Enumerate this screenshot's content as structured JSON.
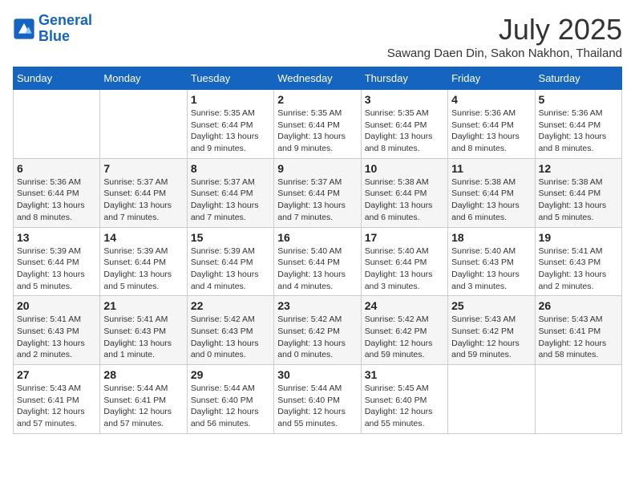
{
  "header": {
    "logo_line1": "General",
    "logo_line2": "Blue",
    "month": "July 2025",
    "location": "Sawang Daen Din, Sakon Nakhon, Thailand"
  },
  "weekdays": [
    "Sunday",
    "Monday",
    "Tuesday",
    "Wednesday",
    "Thursday",
    "Friday",
    "Saturday"
  ],
  "weeks": [
    [
      {
        "day": "",
        "info": ""
      },
      {
        "day": "",
        "info": ""
      },
      {
        "day": "1",
        "info": "Sunrise: 5:35 AM\nSunset: 6:44 PM\nDaylight: 13 hours and 9 minutes."
      },
      {
        "day": "2",
        "info": "Sunrise: 5:35 AM\nSunset: 6:44 PM\nDaylight: 13 hours and 9 minutes."
      },
      {
        "day": "3",
        "info": "Sunrise: 5:35 AM\nSunset: 6:44 PM\nDaylight: 13 hours and 8 minutes."
      },
      {
        "day": "4",
        "info": "Sunrise: 5:36 AM\nSunset: 6:44 PM\nDaylight: 13 hours and 8 minutes."
      },
      {
        "day": "5",
        "info": "Sunrise: 5:36 AM\nSunset: 6:44 PM\nDaylight: 13 hours and 8 minutes."
      }
    ],
    [
      {
        "day": "6",
        "info": "Sunrise: 5:36 AM\nSunset: 6:44 PM\nDaylight: 13 hours and 8 minutes."
      },
      {
        "day": "7",
        "info": "Sunrise: 5:37 AM\nSunset: 6:44 PM\nDaylight: 13 hours and 7 minutes."
      },
      {
        "day": "8",
        "info": "Sunrise: 5:37 AM\nSunset: 6:44 PM\nDaylight: 13 hours and 7 minutes."
      },
      {
        "day": "9",
        "info": "Sunrise: 5:37 AM\nSunset: 6:44 PM\nDaylight: 13 hours and 7 minutes."
      },
      {
        "day": "10",
        "info": "Sunrise: 5:38 AM\nSunset: 6:44 PM\nDaylight: 13 hours and 6 minutes."
      },
      {
        "day": "11",
        "info": "Sunrise: 5:38 AM\nSunset: 6:44 PM\nDaylight: 13 hours and 6 minutes."
      },
      {
        "day": "12",
        "info": "Sunrise: 5:38 AM\nSunset: 6:44 PM\nDaylight: 13 hours and 5 minutes."
      }
    ],
    [
      {
        "day": "13",
        "info": "Sunrise: 5:39 AM\nSunset: 6:44 PM\nDaylight: 13 hours and 5 minutes."
      },
      {
        "day": "14",
        "info": "Sunrise: 5:39 AM\nSunset: 6:44 PM\nDaylight: 13 hours and 5 minutes."
      },
      {
        "day": "15",
        "info": "Sunrise: 5:39 AM\nSunset: 6:44 PM\nDaylight: 13 hours and 4 minutes."
      },
      {
        "day": "16",
        "info": "Sunrise: 5:40 AM\nSunset: 6:44 PM\nDaylight: 13 hours and 4 minutes."
      },
      {
        "day": "17",
        "info": "Sunrise: 5:40 AM\nSunset: 6:44 PM\nDaylight: 13 hours and 3 minutes."
      },
      {
        "day": "18",
        "info": "Sunrise: 5:40 AM\nSunset: 6:43 PM\nDaylight: 13 hours and 3 minutes."
      },
      {
        "day": "19",
        "info": "Sunrise: 5:41 AM\nSunset: 6:43 PM\nDaylight: 13 hours and 2 minutes."
      }
    ],
    [
      {
        "day": "20",
        "info": "Sunrise: 5:41 AM\nSunset: 6:43 PM\nDaylight: 13 hours and 2 minutes."
      },
      {
        "day": "21",
        "info": "Sunrise: 5:41 AM\nSunset: 6:43 PM\nDaylight: 13 hours and 1 minute."
      },
      {
        "day": "22",
        "info": "Sunrise: 5:42 AM\nSunset: 6:43 PM\nDaylight: 13 hours and 0 minutes."
      },
      {
        "day": "23",
        "info": "Sunrise: 5:42 AM\nSunset: 6:42 PM\nDaylight: 13 hours and 0 minutes."
      },
      {
        "day": "24",
        "info": "Sunrise: 5:42 AM\nSunset: 6:42 PM\nDaylight: 12 hours and 59 minutes."
      },
      {
        "day": "25",
        "info": "Sunrise: 5:43 AM\nSunset: 6:42 PM\nDaylight: 12 hours and 59 minutes."
      },
      {
        "day": "26",
        "info": "Sunrise: 5:43 AM\nSunset: 6:41 PM\nDaylight: 12 hours and 58 minutes."
      }
    ],
    [
      {
        "day": "27",
        "info": "Sunrise: 5:43 AM\nSunset: 6:41 PM\nDaylight: 12 hours and 57 minutes."
      },
      {
        "day": "28",
        "info": "Sunrise: 5:44 AM\nSunset: 6:41 PM\nDaylight: 12 hours and 57 minutes."
      },
      {
        "day": "29",
        "info": "Sunrise: 5:44 AM\nSunset: 6:40 PM\nDaylight: 12 hours and 56 minutes."
      },
      {
        "day": "30",
        "info": "Sunrise: 5:44 AM\nSunset: 6:40 PM\nDaylight: 12 hours and 55 minutes."
      },
      {
        "day": "31",
        "info": "Sunrise: 5:45 AM\nSunset: 6:40 PM\nDaylight: 12 hours and 55 minutes."
      },
      {
        "day": "",
        "info": ""
      },
      {
        "day": "",
        "info": ""
      }
    ]
  ]
}
